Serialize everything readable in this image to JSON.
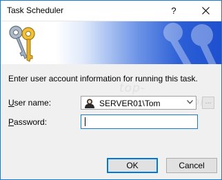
{
  "window": {
    "title": "Task Scheduler",
    "help_glyph": "?",
    "close_icon": "close-icon"
  },
  "banner": {
    "icon": "keys-icon",
    "accent": "#2c5fd6"
  },
  "instruction": "Enter user account information for running this task.",
  "watermark": "top-password.com",
  "user": {
    "label_accel": "U",
    "label_rest": "ser name:",
    "value": "SERVER01\\Tom",
    "browse_label": "..."
  },
  "password": {
    "label_accel": "P",
    "label_rest": "assword:",
    "value": ""
  },
  "buttons": {
    "ok": "OK",
    "cancel": "Cancel"
  }
}
